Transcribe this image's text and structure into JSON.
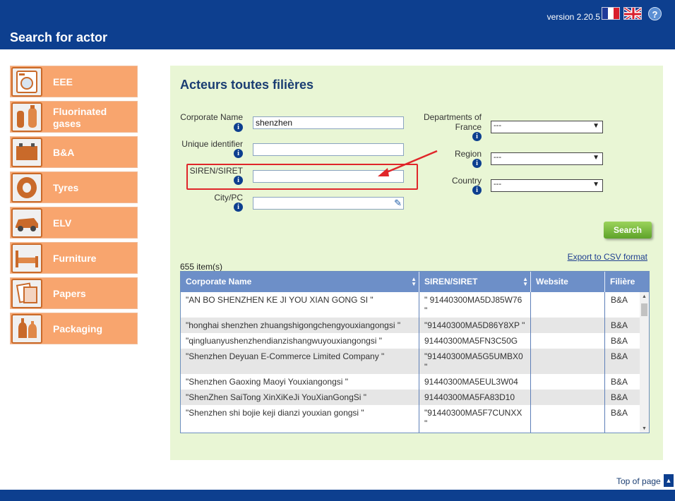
{
  "header": {
    "version": "version 2.20.5",
    "page_title": "Search for actor",
    "help_icon": "?"
  },
  "sidebar": {
    "items": [
      {
        "label": "EEE",
        "icon": "washing-machine-icon"
      },
      {
        "label": "Fluorinated gases",
        "icon": "gas-cylinder-icon"
      },
      {
        "label": "B&A",
        "icon": "battery-icon"
      },
      {
        "label": "Tyres",
        "icon": "tyre-icon"
      },
      {
        "label": "ELV",
        "icon": "car-icon"
      },
      {
        "label": "Furniture",
        "icon": "bed-icon"
      },
      {
        "label": "Papers",
        "icon": "paper-icon"
      },
      {
        "label": "Packaging",
        "icon": "bottles-icon"
      }
    ]
  },
  "form": {
    "title": "Acteurs toutes filières",
    "corporate_name_label": "Corporate Name",
    "corporate_name_value": "shenzhen",
    "unique_id_label": "Unique identifier",
    "unique_id_value": "",
    "siren_label": "SIREN/SIRET",
    "siren_value": "",
    "city_label": "City/PC",
    "city_value": "",
    "departments_label_1": "Departments of",
    "departments_label_2": "France",
    "departments_value": "---",
    "region_label": "Region",
    "region_value": "---",
    "country_label": "Country",
    "country_value": "---",
    "search_button": "Search",
    "export_link": "Export to CSV format",
    "item_count": "655 item(s)"
  },
  "table": {
    "columns": [
      "Corporate Name",
      "SIREN/SIRET",
      "Website",
      "Filière"
    ],
    "rows": [
      {
        "name": "\"AN BO SHENZHEN KE JI YOU XIAN GONG SI \"",
        "siren": "\" 91440300MA5DJ85W76",
        "siren_cont": "\"",
        "website": "",
        "filiere": "B&A"
      },
      {
        "name": "\"honghai shenzhen zhuangshigongchengyouxiangongsi \"",
        "siren": "\"91440300MA5D86Y8XP \"",
        "siren_cont": "",
        "website": "",
        "filiere": "B&A"
      },
      {
        "name": "\"qingluanyushenzhendianzishangwuyouxiangongsi \"",
        "siren": "91440300MA5FN3C50G",
        "siren_cont": "",
        "website": "",
        "filiere": "B&A"
      },
      {
        "name": "\"Shenzhen Deyuan E-Commerce Limited Company \"",
        "siren": "\"91440300MA5G5UMBX0",
        "siren_cont": "\"",
        "website": "",
        "filiere": "B&A"
      },
      {
        "name": "\"Shenzhen Gaoxing Maoyi Youxiangongsi \"",
        "siren": "91440300MA5EUL3W04",
        "siren_cont": "",
        "website": "",
        "filiere": "B&A"
      },
      {
        "name": "\"ShenZhen SaiTong XinXiKeJi YouXianGongSi \"",
        "siren": "91440300MA5FA83D10",
        "siren_cont": "",
        "website": "",
        "filiere": "B&A"
      },
      {
        "name": "\"Shenzhen shi bojie keji dianzi youxian gongsi \"",
        "siren": "\"91440300MA5F7CUNXX",
        "siren_cont": "\"",
        "website": "",
        "filiere": "B&A"
      }
    ]
  },
  "footer": {
    "top_of_page": "Top of page"
  }
}
